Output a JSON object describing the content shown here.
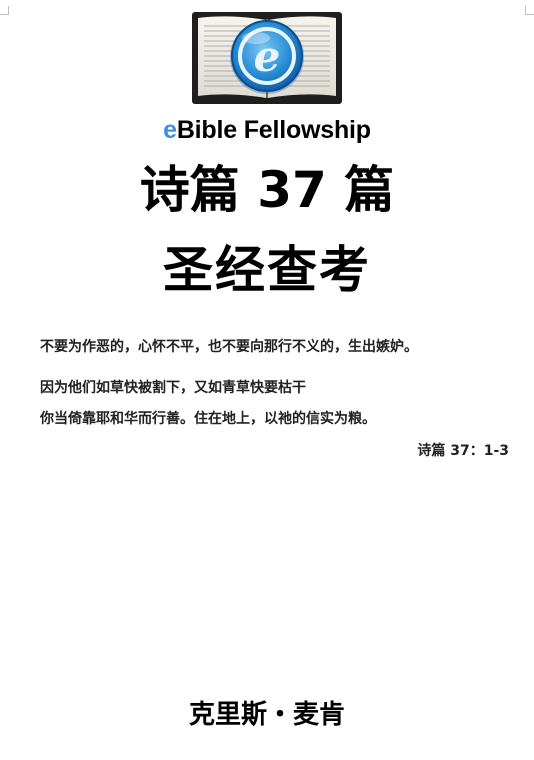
{
  "brand": {
    "prefix": "e",
    "name": "Bible Fellowship"
  },
  "logo": {
    "letter": "e",
    "accent": "#3f8fe0"
  },
  "title": {
    "line1": "诗篇 37 篇",
    "line2": "圣经查考"
  },
  "verse": {
    "line1": "不要为作恶的，心怀不平，也不要向那行不义的，生出嫉妒。",
    "line2": "因为他们如草快被割下，又如青草快要枯干",
    "line3": "你当倚靠耶和华而行善。住在地上，以祂的信实为粮。",
    "reference": "诗篇 37：1-3"
  },
  "author": "克里斯・麦肯"
}
